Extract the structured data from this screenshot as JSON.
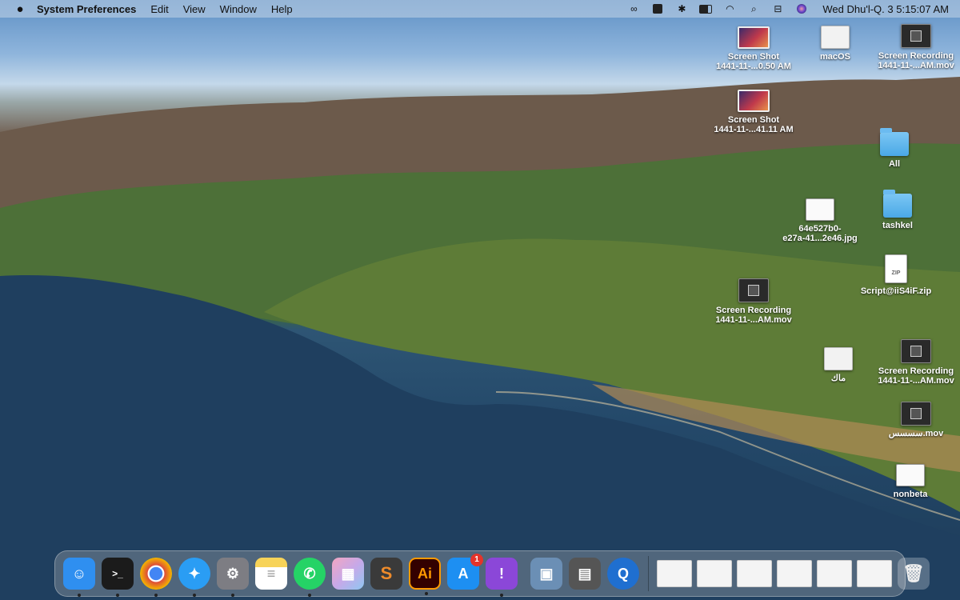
{
  "menubar": {
    "app_name": "System Preferences",
    "menus": [
      "Edit",
      "View",
      "Window",
      "Help"
    ],
    "clock": "Wed Dhu'l-Q. 3  5:15:07 AM",
    "status_icons": [
      "creative-cloud-icon",
      "menu-extra-icon",
      "bluetooth-icon",
      "battery-icon",
      "wifi-icon",
      "spotlight-icon",
      "control-center-icon",
      "siri-icon"
    ]
  },
  "desktop": {
    "icons": [
      {
        "label1": "Screen Shot",
        "label2": "1441-11-...0.50 AM",
        "kind": "screenshot"
      },
      {
        "label1": "macOS",
        "label2": "",
        "kind": "white"
      },
      {
        "label1": "Screen Recording",
        "label2": "1441-11-...AM.mov",
        "kind": "recording"
      },
      {
        "label1": "Screen Shot",
        "label2": "1441-11-...41.11 AM",
        "kind": "screenshot"
      },
      {
        "label1": "All",
        "label2": "",
        "kind": "folder"
      },
      {
        "label1": "tashkel",
        "label2": "",
        "kind": "folder"
      },
      {
        "label1": "64e527b0-",
        "label2": "e27a-41...2e46.jpg",
        "kind": "doc"
      },
      {
        "label1": "Script@iiS4iF.zip",
        "label2": "",
        "kind": "zip"
      },
      {
        "label1": "Screen Recording",
        "label2": "1441-11-...AM.mov",
        "kind": "recording"
      },
      {
        "label1": "ماك",
        "label2": "",
        "kind": "white"
      },
      {
        "label1": "Screen Recording",
        "label2": "1441-11-...AM.mov",
        "kind": "recording"
      },
      {
        "label1": "سسسس.mov",
        "label2": "",
        "kind": "recording"
      },
      {
        "label1": "nonbeta",
        "label2": "",
        "kind": "doc"
      }
    ]
  },
  "dock": {
    "apps": [
      {
        "name": "Finder",
        "glyph": "☺",
        "color": "#2f8ff0",
        "running": true
      },
      {
        "name": "Terminal",
        "glyph": ">_",
        "color": "#1b1b1b",
        "running": true
      },
      {
        "name": "Chrome",
        "glyph": "◉",
        "color": "#dd4b39",
        "running": true
      },
      {
        "name": "Safari",
        "glyph": "✦",
        "color": "#2a9df4",
        "running": true
      },
      {
        "name": "System Preferences",
        "glyph": "⚙",
        "color": "#7d7d83",
        "running": true
      },
      {
        "name": "Notes",
        "glyph": "≡",
        "color": "#f7d358",
        "running": false
      },
      {
        "name": "WhatsApp",
        "glyph": "✆",
        "color": "#25d366",
        "running": true
      },
      {
        "name": "Launchpad",
        "glyph": "▦",
        "color": "#c7a8e8",
        "running": false
      },
      {
        "name": "Sublime Text",
        "glyph": "S",
        "color": "#ef8b2a",
        "running": false
      },
      {
        "name": "Illustrator",
        "glyph": "Ai",
        "color": "#330000",
        "running": true
      },
      {
        "name": "App Store",
        "glyph": "A",
        "color": "#1d8ff2",
        "running": false,
        "badge": "1"
      },
      {
        "name": "Feedback",
        "glyph": "!",
        "color": "#8b47d8",
        "running": true
      }
    ],
    "utilities": [
      {
        "name": "Preview",
        "glyph": "▣",
        "color": "#6b8fb5",
        "running": false
      },
      {
        "name": "Calculator",
        "glyph": "▤",
        "color": "#555555",
        "running": false
      },
      {
        "name": "QuickTime",
        "glyph": "Q",
        "color": "#1f6fd0",
        "running": false
      }
    ],
    "minimized_windows": 6,
    "trash": "Trash"
  },
  "colors": {
    "menubar": "#c4d6e8",
    "badge": "#e5332a"
  }
}
